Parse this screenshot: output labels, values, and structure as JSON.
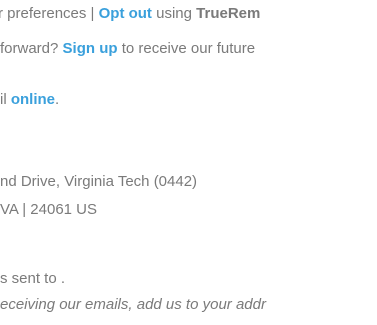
{
  "footer": {
    "preferences_line": {
      "prefix": "r preferences | ",
      "opt_out_link": "Opt out",
      "middle": " using ",
      "brand": "TrueRem"
    },
    "forward_line": {
      "prefix": "forward? ",
      "sign_up_link": "Sign up",
      "suffix": " to receive our future"
    },
    "online_line": {
      "prefix": "il ",
      "online_link": "online",
      "suffix": "."
    },
    "address": {
      "line1": "nd Drive, Virginia Tech (0442)",
      "line2": "VA | 24061 US"
    },
    "sent_to": "s sent to .",
    "contacts_note": "eceiving our emails, add us to your addr"
  }
}
